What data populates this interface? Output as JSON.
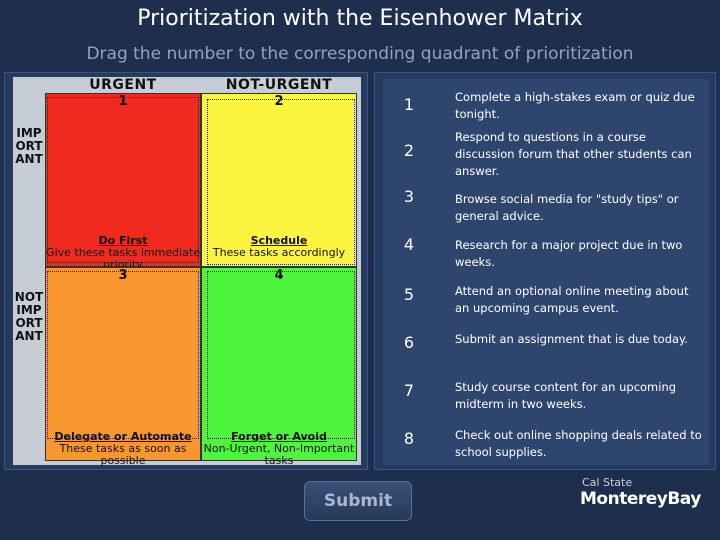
{
  "title": "Prioritization with the Eisenhower Matrix",
  "subtitle": "Drag the number to the corresponding quadrant of prioritization",
  "matrix": {
    "col_urgent": "URGENT",
    "col_not_urgent": "NOT-URGENT",
    "row_important": "IMPORTANT",
    "row_not_important": "NOT IMPORTANT",
    "quadrants": [
      {
        "num": "1",
        "name": "Do First",
        "desc": "Give these tasks immediate priority",
        "color": "#f02a1e"
      },
      {
        "num": "2",
        "name": "Schedule",
        "desc": "These tasks accordingly",
        "color": "#fbf540"
      },
      {
        "num": "3",
        "name": "Delegate or Automate",
        "desc": "These tasks as soon as possible",
        "color": "#f7972e"
      },
      {
        "num": "4",
        "name": "Forget or Avoid",
        "desc": "Non-Urgent, Non-Important tasks",
        "color": "#4df53c"
      }
    ]
  },
  "tasks": [
    {
      "num": "1",
      "text": "Complete a high-stakes exam or quiz due tonight."
    },
    {
      "num": "2",
      "text": "Respond to questions in a course discussion forum that other students can answer."
    },
    {
      "num": "3",
      "text": "Browse social media for \"study tips\" or general advice."
    },
    {
      "num": "4",
      "text": "Research for a major project due in two weeks."
    },
    {
      "num": "5",
      "text": "Attend an optional online meeting about an upcoming campus event."
    },
    {
      "num": "6",
      "text": "Submit an assignment that is due today."
    },
    {
      "num": "7",
      "text": "Study course content for an upcoming midterm in two weeks."
    },
    {
      "num": "8",
      "text": "Check out online shopping deals related to school supplies."
    }
  ],
  "submit_label": "Submit",
  "logo": {
    "line1": "Cal State",
    "line2": "MontereyBay"
  }
}
